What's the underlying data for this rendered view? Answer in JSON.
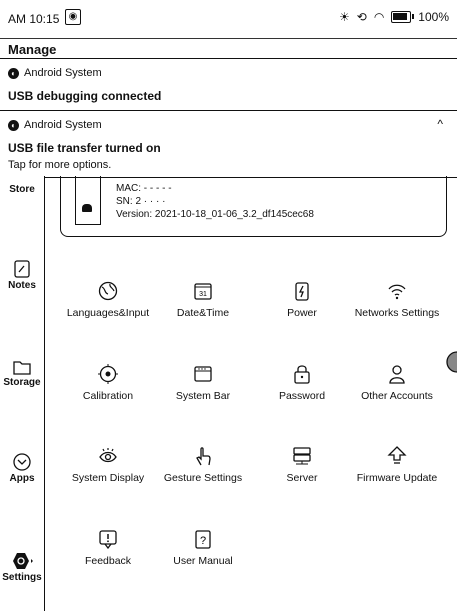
{
  "status": {
    "time": "AM 10:15",
    "app_icon": "◉",
    "battery": "100%"
  },
  "manage": "Manage",
  "notifications": [
    {
      "source": "Android System",
      "title": "USB debugging connected"
    },
    {
      "source": "Android System",
      "title": "USB file transfer turned on",
      "subtitle": "Tap for more options."
    }
  ],
  "sidebar": [
    {
      "label": "Store"
    },
    {
      "label": "Notes"
    },
    {
      "label": "Storage"
    },
    {
      "label": "Apps"
    },
    {
      "label": "Settings"
    }
  ],
  "device": {
    "mac": "MAC: - - - - -",
    "sn": "SN: 2  ·  ·  ·  ·",
    "version": "Version: 2021-10-18_01-06_3.2_df145cec68"
  },
  "settings": [
    {
      "label": "Languages&Input",
      "icon": "globe-icon"
    },
    {
      "label": "Date&Time",
      "icon": "calendar-icon"
    },
    {
      "label": "Power",
      "icon": "battery-bolt-icon"
    },
    {
      "label": "Networks Settings",
      "icon": "wifi-icon"
    },
    {
      "label": "Calibration",
      "icon": "target-icon"
    },
    {
      "label": "System Bar",
      "icon": "system-bar-icon"
    },
    {
      "label": "Password",
      "icon": "lock-icon"
    },
    {
      "label": "Other Accounts",
      "icon": "person-icon"
    },
    {
      "label": "System Display",
      "icon": "eye-icon"
    },
    {
      "label": "Gesture Settings",
      "icon": "hand-icon"
    },
    {
      "label": "Server",
      "icon": "server-icon"
    },
    {
      "label": "Firmware Update",
      "icon": "upload-icon"
    },
    {
      "label": "Feedback",
      "icon": "feedback-icon"
    },
    {
      "label": "User Manual",
      "icon": "manual-icon"
    }
  ]
}
